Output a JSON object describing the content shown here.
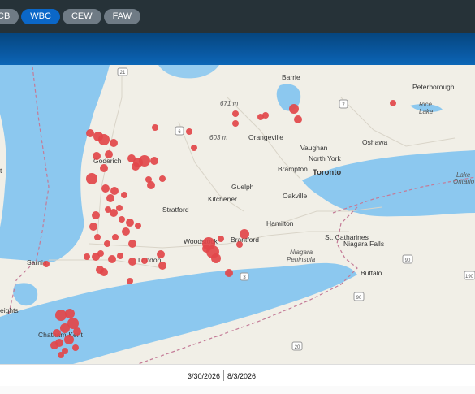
{
  "tabs": [
    {
      "label": "CB",
      "active": false
    },
    {
      "label": "WBC",
      "active": true
    },
    {
      "label": "CEW",
      "active": false
    },
    {
      "label": "FAW",
      "active": false
    }
  ],
  "map": {
    "places": {
      "barrie": "Barrie",
      "peterborough": "Peterborough",
      "orangeville": "Orangeville",
      "vaughan": "Vaughan",
      "oshawa": "Oshawa",
      "north_york": "North York",
      "brampton": "Brampton",
      "toronto": "Toronto",
      "goderich": "Goderich",
      "guelph": "Guelph",
      "oakville": "Oakville",
      "kitchener": "Kitchener",
      "stratford": "Stratford",
      "hamilton": "Hamilton",
      "st_catharines": "St. Catharines",
      "niagara_falls": "Niagara Falls",
      "woodstock": "Woodstock",
      "brantford": "Brantford",
      "niagara_peninsula": "Niagara",
      "peninsula": "Peninsula",
      "sarnia": "Sarnia",
      "london": "London",
      "buffalo": "Buffalo",
      "chatham_kent": "Chatham-Kent",
      "heights": "eights",
      "rice_lake": "Rice",
      "rice_lake2": "Lake",
      "lake_ontario": "Lake",
      "lake_ontario2": "Ontario",
      "elev1": "671 m",
      "elev2": "603 m",
      "hwy21": "21",
      "hwy7": "7",
      "hwy6": "6",
      "hwy3": "3",
      "hwy90": "90",
      "hwy190": "190",
      "hwy20": "20",
      "hwy90b": "90",
      "edge_t": "t"
    }
  },
  "footer": {
    "start_date": "3/30/2026",
    "end_date": "8/3/2026"
  },
  "colors": {
    "marker": "#e2474a",
    "active_tab": "#0b67c8",
    "water": "#8cc8ef"
  }
}
